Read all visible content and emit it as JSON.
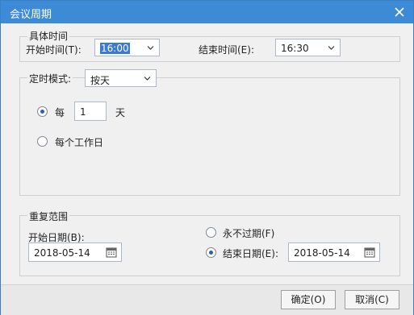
{
  "window": {
    "title": "会议周期"
  },
  "time_group": {
    "title": "具体时间",
    "start_label": "开始时间(T):",
    "start_value": "16:00",
    "end_label": "结束时间(E):",
    "end_value": "16:30"
  },
  "mode_group": {
    "title": "定时模式:",
    "mode_value": "按天",
    "every_label": "每",
    "every_value": "1",
    "every_unit": "天",
    "workday_label": "每个工作日",
    "selected": "every"
  },
  "repeat_group": {
    "title": "重复范围",
    "start_date_label": "开始日期(B):",
    "start_date_value": "2018-05-14",
    "never_label": "永不过期(F)",
    "end_date_label": "结束日期(E):",
    "end_date_value": "2018-05-14",
    "selected": "end_date"
  },
  "buttons": {
    "ok": "确定(O)",
    "cancel": "取消(C)"
  },
  "icons": {
    "close": "close-icon",
    "dropdown": "chevron-down-icon",
    "calendar": "calendar-icon"
  }
}
